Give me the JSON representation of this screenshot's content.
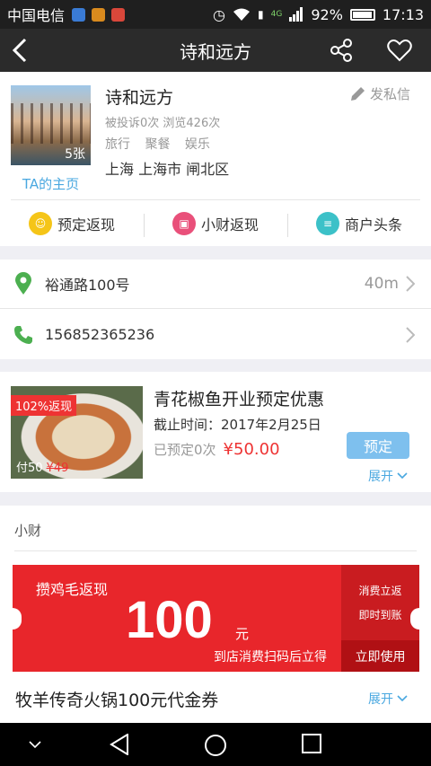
{
  "status_bar": {
    "carrier": "中国电信",
    "battery": "92%",
    "time": "17:13",
    "network": "4G"
  },
  "header": {
    "title": "诗和远方"
  },
  "profile": {
    "name": "诗和远方",
    "photo_count": "5张",
    "home_link": "TA的主页",
    "stats": "被投诉0次  浏览426次",
    "tags": [
      "旅行",
      "聚餐",
      "娱乐"
    ],
    "location": "上海 上海市 闸北区",
    "message_label": "发私信"
  },
  "features": [
    {
      "label": "预定返现",
      "icon": "smile-coin-icon",
      "color": "#f5c518"
    },
    {
      "label": "小财返现",
      "icon": "wallet-icon",
      "color": "#e9507a"
    },
    {
      "label": "商户头条",
      "icon": "news-icon",
      "color": "#3cc1c8"
    }
  ],
  "address": {
    "text": "裕通路100号",
    "distance": "40m"
  },
  "phone": {
    "text": "156852365236"
  },
  "deal": {
    "badge": "102%返现",
    "paid": "付50",
    "original": "¥49",
    "title": "青花椒鱼开业预定优惠",
    "deadline": "截止时间：2017年2月25日",
    "booked": "已预定0次",
    "price": "¥50.00",
    "book_label": "预定",
    "expand_label": "展开"
  },
  "coupon_section": {
    "label": "小财",
    "coupon": {
      "name": "攒鸡毛返现",
      "amount": "100",
      "unit": "元",
      "note": "到店消费扫码后立得",
      "side_line1": "消费立返",
      "side_line2": "即时到账",
      "use_label": "立即使用"
    },
    "title": "牧羊传奇火锅100元代金券",
    "expand_label": "展开"
  },
  "colors": {
    "accent_blue": "#4aa8e0",
    "price_red": "#e33",
    "coupon_red": "#e8262b",
    "header_bg": "#2b2b2b"
  }
}
